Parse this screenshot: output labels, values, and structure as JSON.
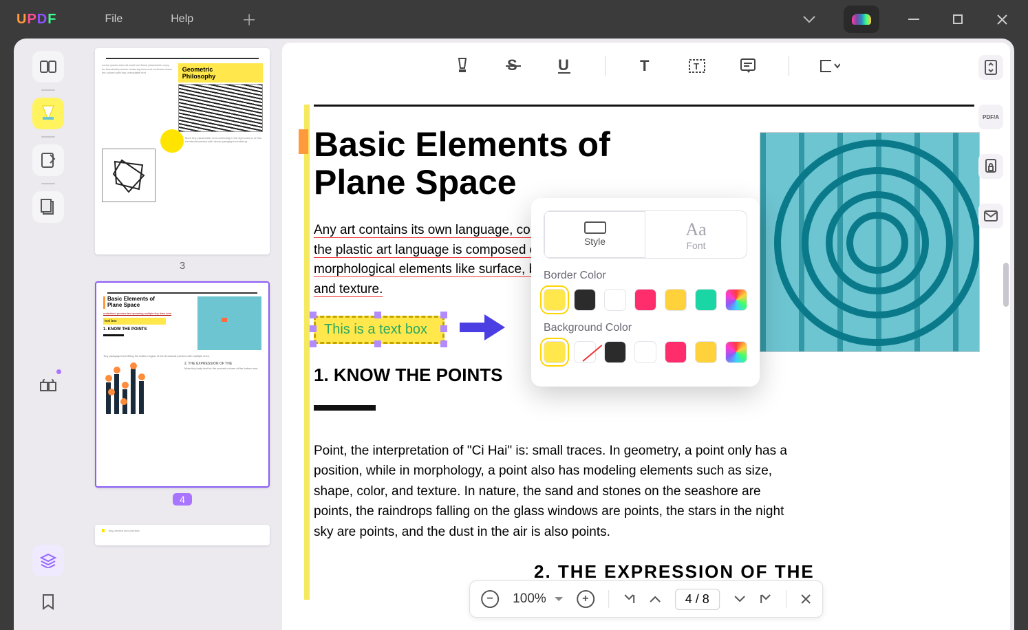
{
  "app": {
    "logo": [
      "U",
      "P",
      "D",
      "F"
    ]
  },
  "menu": {
    "file": "File",
    "help": "Help"
  },
  "thumbs": [
    {
      "num": "3",
      "selected": false
    },
    {
      "num": "4",
      "selected": true
    }
  ],
  "page": {
    "title": "Basic Elements of Plane Space",
    "underlined": "Any art contains its own language, composition of the plastic art language is composed of morphological elements like surface, body, color and texture.",
    "textbox": "This is a text box",
    "heading1": "1. KNOW THE POINTS",
    "para2": "Point, the interpretation of \"Ci Hai\" is: small traces. In geometry, a point only has a position, while in morphology, a point also has modeling elements such as size, shape, color, and texture. In nature, the sand and stones on the seashore are points, the raindrops falling on the glass windows are points, the stars in the night sky are points, and the dust in the air is also points.",
    "heading2": "2. THE  EXPRESSION   OF  THE"
  },
  "popup": {
    "tab_style": "Style",
    "tab_font": "Font",
    "label_border": "Border Color",
    "label_bg": "Background Color",
    "border_colors": [
      "#ffe74c",
      "#2b2b2b",
      "#ffffff",
      "#ff2d6b",
      "#ffd23b",
      "#1ad6a4",
      "multi"
    ],
    "bg_colors": [
      "#ffe74c",
      "none",
      "#2b2b2b",
      "#ffffff",
      "#ff2d6b",
      "#ffd23b",
      "multi"
    ]
  },
  "zoom": {
    "value": "100%",
    "page": "4 / 8"
  },
  "right_rail": {
    "pdfa": "PDF/A"
  }
}
